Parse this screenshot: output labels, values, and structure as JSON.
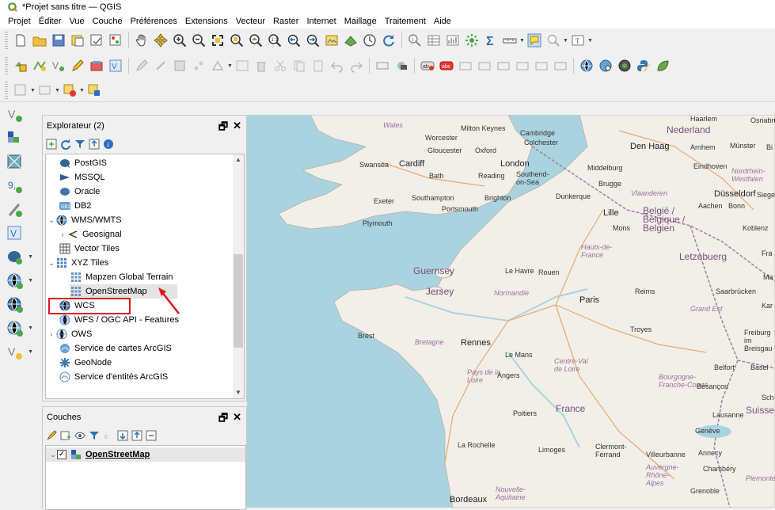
{
  "window": {
    "title": "*Projet sans titre — QGIS"
  },
  "menu": [
    "Projet",
    "Éditer",
    "Vue",
    "Couche",
    "Préférences",
    "Extensions",
    "Vecteur",
    "Raster",
    "Internet",
    "Maillage",
    "Traitement",
    "Aide"
  ],
  "explorer": {
    "title": "Explorateur (2)",
    "items": [
      {
        "label": "PostGIS",
        "icon": "postgis-icon"
      },
      {
        "label": "MSSQL",
        "icon": "mssql-icon"
      },
      {
        "label": "Oracle",
        "icon": "oracle-icon"
      },
      {
        "label": "DB2",
        "icon": "db2-icon"
      },
      {
        "label": "WMS/WMTS",
        "icon": "wms-icon"
      },
      {
        "label": "Geosignal",
        "icon": "geosignal-icon"
      },
      {
        "label": "Vector Tiles",
        "icon": "vector-tiles-icon"
      },
      {
        "label": "XYZ Tiles",
        "icon": "xyz-tiles-icon"
      },
      {
        "label": "Mapzen Global Terrain",
        "icon": "tile-grid-icon"
      },
      {
        "label": "OpenStreetMap",
        "icon": "tile-grid-icon"
      },
      {
        "label": "WCS",
        "icon": "wcs-icon"
      },
      {
        "label": "WFS / OGC API - Features",
        "icon": "wfs-icon"
      },
      {
        "label": "OWS",
        "icon": "ows-icon"
      },
      {
        "label": "Service de cartes ArcGIS",
        "icon": "arcgis-map-icon"
      },
      {
        "label": "GeoNode",
        "icon": "geonode-icon"
      },
      {
        "label": "Service d'entités ArcGIS",
        "icon": "arcgis-feature-icon"
      }
    ]
  },
  "layers": {
    "title": "Couches",
    "items": [
      {
        "label": "OpenStreetMap",
        "checked": true
      }
    ]
  },
  "map": {
    "places": [
      {
        "name": "Wales",
        "cls": "reg"
      },
      {
        "name": "Milton Keynes",
        "cls": ""
      },
      {
        "name": "Cambridge",
        "cls": ""
      },
      {
        "name": "Worcester",
        "cls": ""
      },
      {
        "name": "Colchester",
        "cls": ""
      },
      {
        "name": "Gloucester",
        "cls": ""
      },
      {
        "name": "Oxford",
        "cls": ""
      },
      {
        "name": "Swansea",
        "cls": ""
      },
      {
        "name": "Cardiff",
        "cls": "big"
      },
      {
        "name": "London",
        "cls": "big"
      },
      {
        "name": "Bath",
        "cls": ""
      },
      {
        "name": "Reading",
        "cls": ""
      },
      {
        "name": "Southend-on-Sea",
        "cls": ""
      },
      {
        "name": "Exeter",
        "cls": ""
      },
      {
        "name": "Southampton",
        "cls": ""
      },
      {
        "name": "Brighton",
        "cls": ""
      },
      {
        "name": "Portsmouth",
        "cls": ""
      },
      {
        "name": "Plymouth",
        "cls": ""
      },
      {
        "name": "Nederland",
        "cls": "country"
      },
      {
        "name": "Den Haag",
        "cls": "big"
      },
      {
        "name": "Arnhem",
        "cls": ""
      },
      {
        "name": "Münster",
        "cls": ""
      },
      {
        "name": "Middelburg",
        "cls": ""
      },
      {
        "name": "Eindhoven",
        "cls": ""
      },
      {
        "name": "Nordrhein-Westfalen",
        "cls": "reg"
      },
      {
        "name": "Brugge",
        "cls": ""
      },
      {
        "name": "Vlaanderen",
        "cls": "reg"
      },
      {
        "name": "Düsseldorf",
        "cls": "big"
      },
      {
        "name": "Dunkerque",
        "cls": ""
      },
      {
        "name": "Lille",
        "cls": "big"
      },
      {
        "name": "Aachen",
        "cls": ""
      },
      {
        "name": "Bonn",
        "cls": ""
      },
      {
        "name": "België / Belgique / Belgien",
        "cls": "country"
      },
      {
        "name": "Mons",
        "cls": ""
      },
      {
        "name": "Koblenz",
        "cls": ""
      },
      {
        "name": "Hauts-de-France",
        "cls": "reg"
      },
      {
        "name": "Letzebuerg",
        "cls": "country"
      },
      {
        "name": "Guernsey",
        "cls": "country"
      },
      {
        "name": "Le Havre",
        "cls": ""
      },
      {
        "name": "Rouen",
        "cls": ""
      },
      {
        "name": "Jersey",
        "cls": "country"
      },
      {
        "name": "Normandie",
        "cls": "reg"
      },
      {
        "name": "Paris",
        "cls": "big"
      },
      {
        "name": "Reims",
        "cls": ""
      },
      {
        "name": "Saarbrücken",
        "cls": ""
      },
      {
        "name": "Grand Est",
        "cls": "reg"
      },
      {
        "name": "Brest",
        "cls": ""
      },
      {
        "name": "Troyes",
        "cls": ""
      },
      {
        "name": "Bretagne",
        "cls": "reg"
      },
      {
        "name": "Rennes",
        "cls": "big"
      },
      {
        "name": "Freiburg im Breisgau",
        "cls": ""
      },
      {
        "name": "Le Mans",
        "cls": ""
      },
      {
        "name": "Centre-Val de Loire",
        "cls": "reg"
      },
      {
        "name": "Pays de la Loire",
        "cls": "reg"
      },
      {
        "name": "Angers",
        "cls": ""
      },
      {
        "name": "Bourgogne-Franche-Comté",
        "cls": "reg"
      },
      {
        "name": "Belfort",
        "cls": ""
      },
      {
        "name": "Basel",
        "cls": ""
      },
      {
        "name": "Besançon",
        "cls": ""
      },
      {
        "name": "France",
        "cls": "country"
      },
      {
        "name": "Poitiers",
        "cls": ""
      },
      {
        "name": "Lausanne",
        "cls": ""
      },
      {
        "name": "Genève",
        "cls": ""
      },
      {
        "name": "La Rochelle",
        "cls": ""
      },
      {
        "name": "Limoges",
        "cls": ""
      },
      {
        "name": "Clermont-Ferrand",
        "cls": ""
      },
      {
        "name": "Villeurbanne",
        "cls": ""
      },
      {
        "name": "Annecy",
        "cls": ""
      },
      {
        "name": "Chambéry",
        "cls": ""
      },
      {
        "name": "Auvergne-Rhône-Alpes",
        "cls": "reg"
      },
      {
        "name": "Grenoble",
        "cls": ""
      },
      {
        "name": "Bordeaux",
        "cls": "big"
      },
      {
        "name": "Nouvelle-Aquitaine",
        "cls": "reg"
      },
      {
        "name": "Osnabrü",
        "cls": ""
      },
      {
        "name": "Bi",
        "cls": ""
      },
      {
        "name": "Sieger",
        "cls": ""
      },
      {
        "name": "Fra",
        "cls": ""
      },
      {
        "name": "Ma",
        "cls": ""
      },
      {
        "name": "Kar",
        "cls": ""
      },
      {
        "name": "Sch",
        "cls": ""
      },
      {
        "name": "Suisse",
        "cls": "country"
      },
      {
        "name": "Piemonte",
        "cls": "reg"
      },
      {
        "name": "Haarlem",
        "cls": ""
      }
    ]
  },
  "colors": {
    "highlight": "#e0141e",
    "sea": "#aad3df",
    "land": "#f2efe9"
  }
}
